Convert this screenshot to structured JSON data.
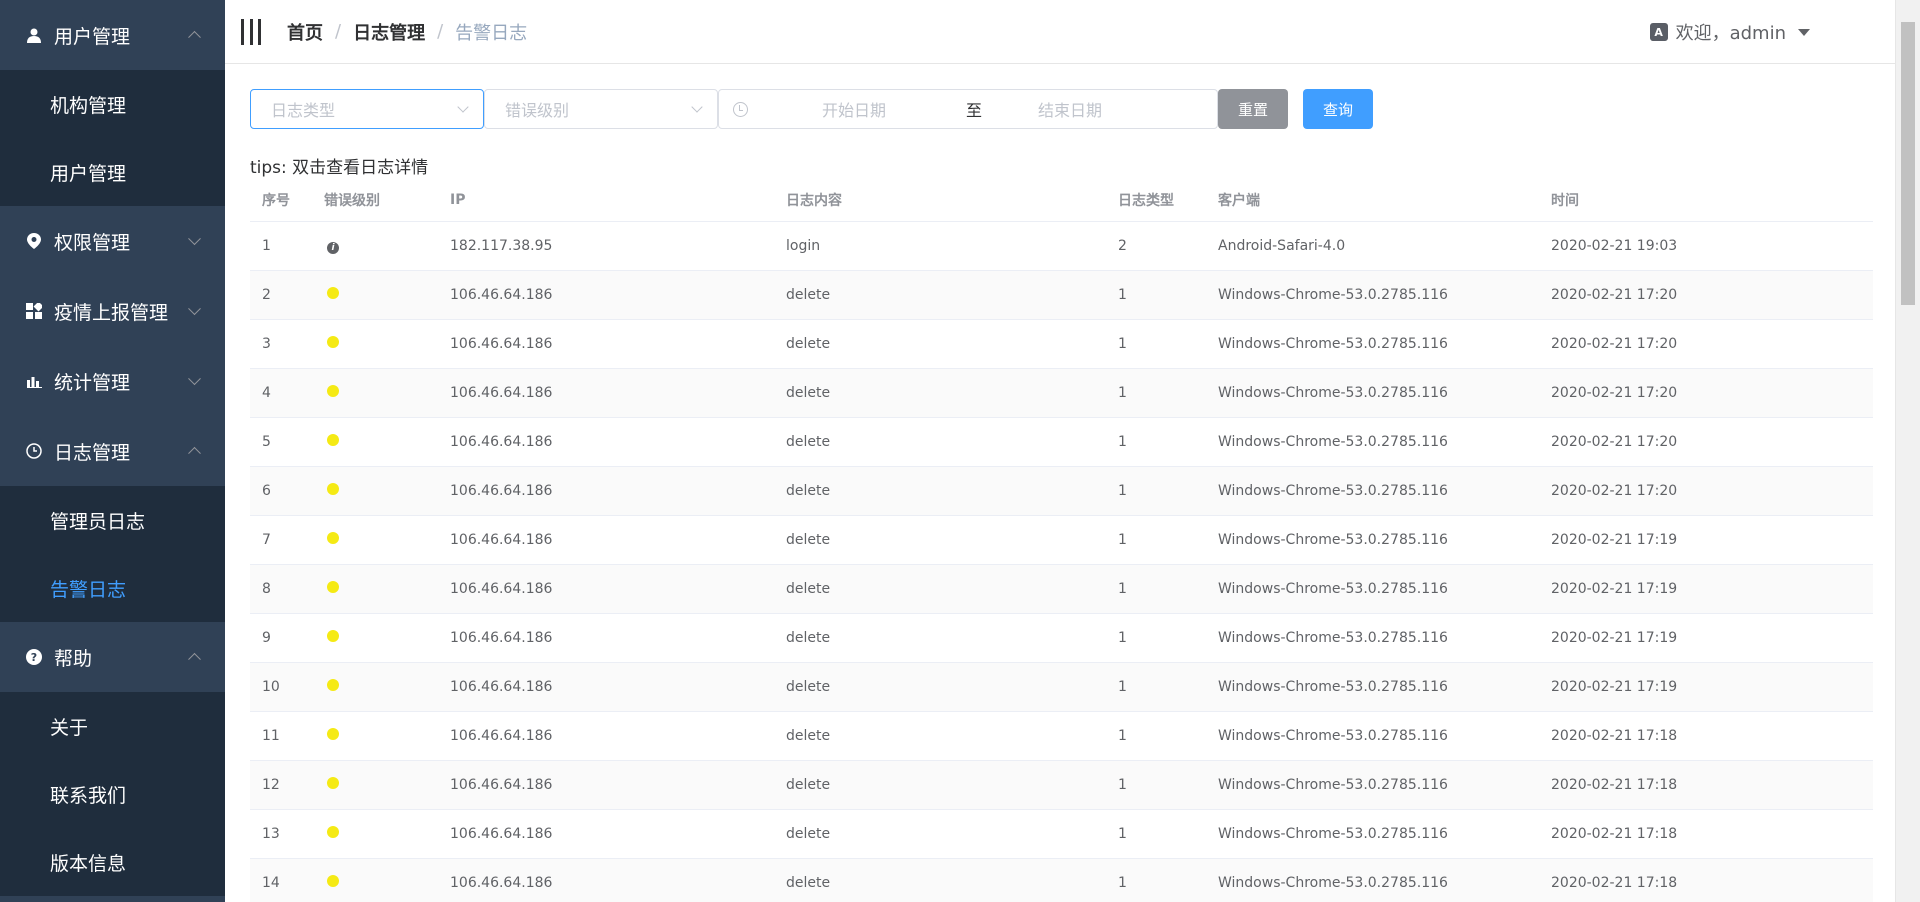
{
  "sidebar": {
    "groups": [
      {
        "label": "用户管理",
        "icon": "user-icon",
        "expanded": true,
        "items": [
          "机构管理",
          "用户管理"
        ]
      },
      {
        "label": "权限管理",
        "icon": "location-icon",
        "expanded": false,
        "items": []
      },
      {
        "label": "疫情上报管理",
        "icon": "grid-icon",
        "expanded": false,
        "items": []
      },
      {
        "label": "统计管理",
        "icon": "chart-icon",
        "expanded": false,
        "items": []
      },
      {
        "label": "日志管理",
        "icon": "clock-icon",
        "expanded": true,
        "items": [
          "管理员日志",
          "告警日志"
        ]
      },
      {
        "label": "帮助",
        "icon": "question-icon",
        "expanded": true,
        "items": [
          "关于",
          "联系我们",
          "版本信息"
        ]
      }
    ],
    "active_item": "告警日志",
    "colors": {
      "bg": "#304156",
      "submenu_bg": "#1f2d3d",
      "active": "#409eff"
    }
  },
  "header": {
    "breadcrumb": [
      "首页",
      "日志管理",
      "告警日志"
    ],
    "welcome": "欢迎，admin",
    "lang_icon_text": "A"
  },
  "filters": {
    "log_type_placeholder": "日志类型",
    "error_level_placeholder": "错误级别",
    "start_date_placeholder": "开始日期",
    "range_separator": "至",
    "end_date_placeholder": "结束日期",
    "reset_label": "重置",
    "query_label": "查询"
  },
  "tips": "tips: 双击查看日志详情",
  "table": {
    "columns": [
      "序号",
      "错误级别",
      "IP",
      "日志内容",
      "日志类型",
      "客户端",
      "时间"
    ],
    "rows": [
      {
        "no": "1",
        "level": "info",
        "level_glyph": "i",
        "ip": "182.117.38.95",
        "content": "login",
        "type": "2",
        "client": "Android-Safari-4.0",
        "time": "2020-02-21 19:03"
      },
      {
        "no": "2",
        "level": "warn",
        "ip": "106.46.64.186",
        "content": "delete",
        "type": "1",
        "client": "Windows-Chrome-53.0.2785.116",
        "time": "2020-02-21 17:20"
      },
      {
        "no": "3",
        "level": "warn",
        "ip": "106.46.64.186",
        "content": "delete",
        "type": "1",
        "client": "Windows-Chrome-53.0.2785.116",
        "time": "2020-02-21 17:20"
      },
      {
        "no": "4",
        "level": "warn",
        "ip": "106.46.64.186",
        "content": "delete",
        "type": "1",
        "client": "Windows-Chrome-53.0.2785.116",
        "time": "2020-02-21 17:20"
      },
      {
        "no": "5",
        "level": "warn",
        "ip": "106.46.64.186",
        "content": "delete",
        "type": "1",
        "client": "Windows-Chrome-53.0.2785.116",
        "time": "2020-02-21 17:20"
      },
      {
        "no": "6",
        "level": "warn",
        "ip": "106.46.64.186",
        "content": "delete",
        "type": "1",
        "client": "Windows-Chrome-53.0.2785.116",
        "time": "2020-02-21 17:20"
      },
      {
        "no": "7",
        "level": "warn",
        "ip": "106.46.64.186",
        "content": "delete",
        "type": "1",
        "client": "Windows-Chrome-53.0.2785.116",
        "time": "2020-02-21 17:19"
      },
      {
        "no": "8",
        "level": "warn",
        "ip": "106.46.64.186",
        "content": "delete",
        "type": "1",
        "client": "Windows-Chrome-53.0.2785.116",
        "time": "2020-02-21 17:19"
      },
      {
        "no": "9",
        "level": "warn",
        "ip": "106.46.64.186",
        "content": "delete",
        "type": "1",
        "client": "Windows-Chrome-53.0.2785.116",
        "time": "2020-02-21 17:19"
      },
      {
        "no": "10",
        "level": "warn",
        "ip": "106.46.64.186",
        "content": "delete",
        "type": "1",
        "client": "Windows-Chrome-53.0.2785.116",
        "time": "2020-02-21 17:19"
      },
      {
        "no": "11",
        "level": "warn",
        "ip": "106.46.64.186",
        "content": "delete",
        "type": "1",
        "client": "Windows-Chrome-53.0.2785.116",
        "time": "2020-02-21 17:18"
      },
      {
        "no": "12",
        "level": "warn",
        "ip": "106.46.64.186",
        "content": "delete",
        "type": "1",
        "client": "Windows-Chrome-53.0.2785.116",
        "time": "2020-02-21 17:18"
      },
      {
        "no": "13",
        "level": "warn",
        "ip": "106.46.64.186",
        "content": "delete",
        "type": "1",
        "client": "Windows-Chrome-53.0.2785.116",
        "time": "2020-02-21 17:18"
      },
      {
        "no": "14",
        "level": "warn",
        "ip": "106.46.64.186",
        "content": "delete",
        "type": "1",
        "client": "Windows-Chrome-53.0.2785.116",
        "time": "2020-02-21 17:18"
      }
    ]
  }
}
